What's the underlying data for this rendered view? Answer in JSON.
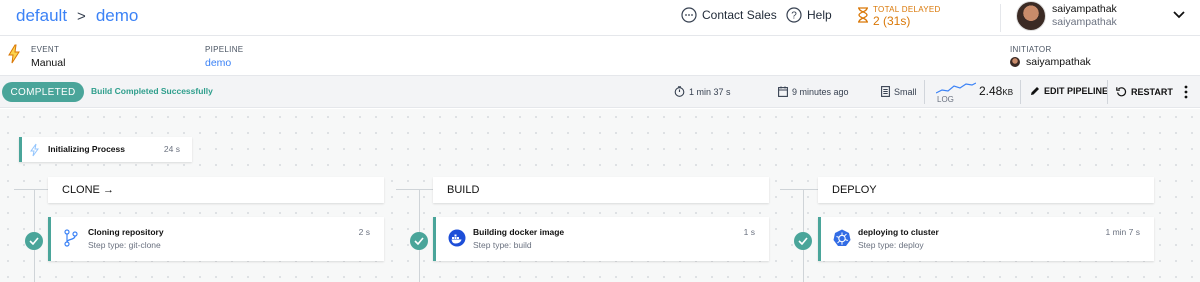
{
  "header": {
    "breadcrumb": {
      "project": "default",
      "separator": ">",
      "pipeline": "demo"
    },
    "contact_sales": "Contact Sales",
    "help": "Help",
    "total_delayed_label": "TOTAL DELAYED",
    "total_delayed_value": "2 (31s)",
    "user": {
      "name": "saiyampathak",
      "org": "saiyampathak"
    }
  },
  "info": {
    "event_label": "EVENT",
    "event_value": "Manual",
    "pipeline_label": "PIPELINE",
    "pipeline_value": "demo",
    "initiator_label": "INITIATOR",
    "initiator_value": "saiyampathak"
  },
  "status_bar": {
    "status": "COMPLETED",
    "status_message": "Build Completed Successfully",
    "duration": "1 min 37 s",
    "started": "9 minutes ago",
    "size": "Small",
    "log_label": "LOG",
    "log_size_value": "2.48",
    "log_size_unit": "KB",
    "edit_pipeline": "EDIT PIPELINE",
    "restart": "RESTART"
  },
  "workflow": {
    "init": {
      "title": "Initializing Process",
      "duration": "24 s"
    },
    "stages": [
      {
        "name": "CLONE →",
        "step": {
          "title": "Cloning repository",
          "type": "Step type: git-clone",
          "duration": "2 s",
          "icon": "git-branch-icon"
        }
      },
      {
        "name": "BUILD",
        "step": {
          "title": "Building docker image",
          "type": "Step type: build",
          "duration": "1 s",
          "icon": "docker-icon"
        }
      },
      {
        "name": "DEPLOY",
        "step": {
          "title": "deploying to cluster",
          "type": "Step type: deploy",
          "duration": "1 min 7 s",
          "icon": "kubernetes-icon"
        }
      }
    ]
  },
  "colors": {
    "accent": "#4aa59a",
    "link": "#3b82f6",
    "warning": "#d97706"
  }
}
